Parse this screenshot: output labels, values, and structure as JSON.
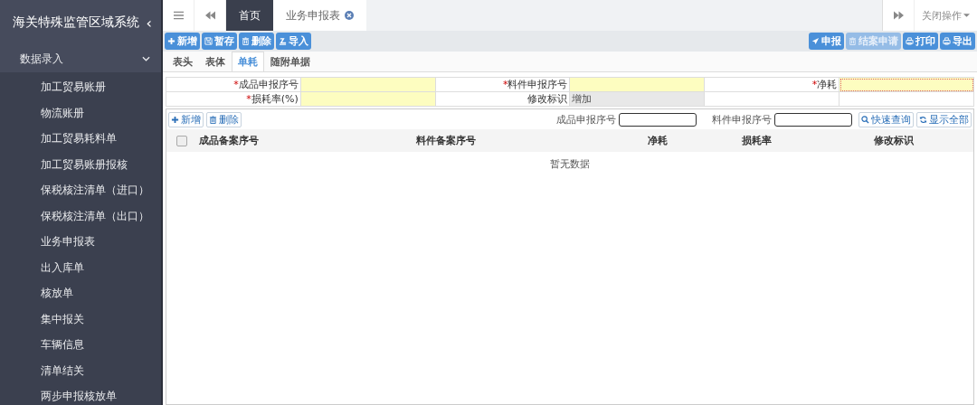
{
  "sidebar": {
    "title": "海关特殊监管区域系统",
    "collapse_icon": "‹",
    "group": {
      "label": "数据录入",
      "expanded": true,
      "items": [
        "加工贸易账册",
        "物流账册",
        "加工贸易耗料单",
        "加工贸易账册报核",
        "保税核注清单（进口）",
        "保税核注清单（出口）",
        "业务申报表",
        "出入库单",
        "核放单",
        "集中报关",
        "车辆信息",
        "清单结关",
        "两步申报核放单"
      ]
    }
  },
  "tabbar": {
    "tabs": [
      {
        "label": "首页",
        "selected": true,
        "closable": false
      },
      {
        "label": "业务申报表",
        "selected": false,
        "closable": true
      }
    ],
    "close_menu": "关闭操作"
  },
  "toolbar": {
    "left": [
      {
        "label": "新增",
        "disabled": false
      },
      {
        "label": "暂存",
        "disabled": false
      },
      {
        "label": "删除",
        "disabled": false
      },
      {
        "label": "导入",
        "disabled": false
      }
    ],
    "right": [
      {
        "label": "申报",
        "disabled": false
      },
      {
        "label": "结案申请",
        "disabled": true
      },
      {
        "label": "打印",
        "disabled": false
      },
      {
        "label": "导出",
        "disabled": false
      }
    ]
  },
  "subtabs": [
    {
      "label": "表头",
      "selected": false
    },
    {
      "label": "表体",
      "selected": false
    },
    {
      "label": "单耗",
      "selected": true
    },
    {
      "label": "随附单据",
      "selected": false
    }
  ],
  "form": {
    "rows": [
      [
        {
          "label": "成品申报序号",
          "required_mark": "*",
          "kind": "input"
        },
        {
          "label": "料件申报序号",
          "required_mark": "*",
          "kind": "input"
        },
        {
          "label": "净耗",
          "required_mark": "*",
          "kind": "input"
        }
      ],
      [
        {
          "label": "损耗率(%)",
          "required_mark": "*",
          "kind": "input"
        },
        {
          "label": "修改标识",
          "value": "增加",
          "kind": "readonly"
        }
      ]
    ]
  },
  "grid": {
    "actions": [
      {
        "label": "新增"
      },
      {
        "label": "删除"
      }
    ],
    "filters": [
      {
        "label": "成品申报序号"
      },
      {
        "label": "料件申报序号"
      }
    ],
    "buttons": [
      {
        "label": "快速查询"
      },
      {
        "label": "显示全部"
      }
    ],
    "select_all": {
      "checked": false
    },
    "columns": [
      "成品备案序号",
      "料件备案序号",
      "净耗",
      "损耗率",
      "修改标识"
    ],
    "empty_text": "暂无数据"
  }
}
